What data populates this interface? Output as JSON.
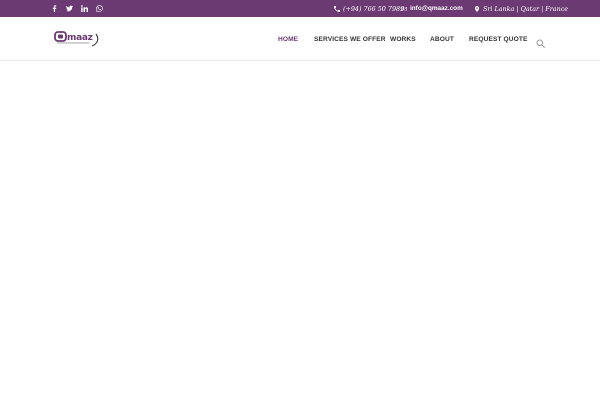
{
  "topbar": {
    "social_icons": [
      "facebook-icon",
      "twitter-icon",
      "linkedin-icon",
      "whatsapp-icon"
    ],
    "phone": "(+94) 766 50 7989",
    "email": "info@qmaaz.com",
    "locations": "Sri Lanka | Qatar | France"
  },
  "header": {
    "logo_text": "qmaaz",
    "logo_tagline": "go beyond expectations",
    "nav": [
      {
        "label": "HOME",
        "active": true
      },
      {
        "label": "SERVICES WE OFFER",
        "active": false
      },
      {
        "label": "WORKS",
        "active": false
      },
      {
        "label": "ABOUT",
        "active": false
      },
      {
        "label": "REQUEST QUOTE",
        "active": false
      }
    ],
    "search_icon": "search-icon"
  },
  "colors": {
    "brand": "#6b3a73",
    "text": "#333333",
    "background": "#ffffff"
  }
}
